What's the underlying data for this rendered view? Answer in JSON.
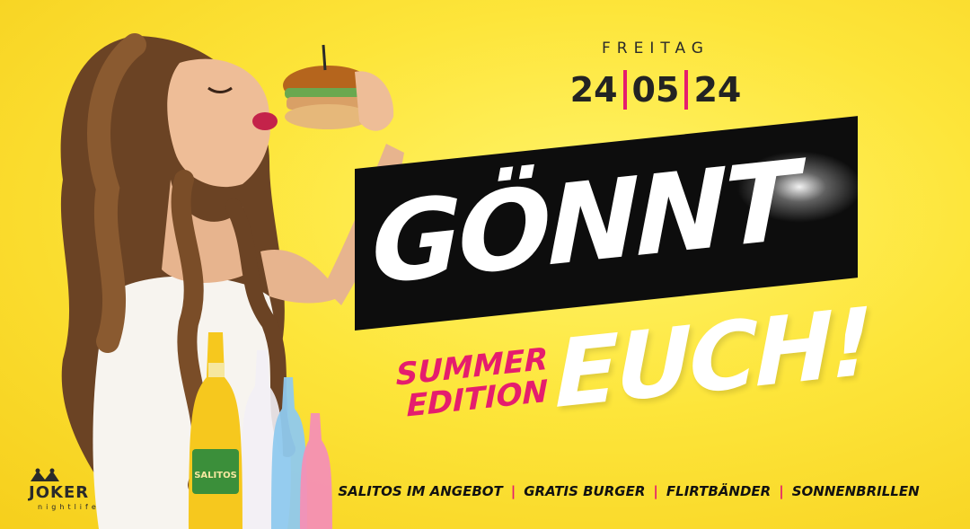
{
  "event": {
    "day": "FREITAG",
    "date_day": "24",
    "date_month": "05",
    "date_year": "24"
  },
  "headline": {
    "word1": "GÖNNT",
    "word2": "EUCH!",
    "edition_line1": "SUMMER",
    "edition_line2": "EDITION"
  },
  "features": [
    "SALITOS IM ANGEBOT",
    "GRATIS BURGER",
    "FLIRTBÄNDER",
    "SONNENBRILLEN"
  ],
  "feature_separator": "|",
  "brand": {
    "name": "JOKER",
    "tagline": "nightlife"
  },
  "bottle_label": "SALITOS",
  "colors": {
    "background": "#fde53a",
    "accent": "#e51d6e",
    "banner": "#0d0d0d",
    "text": "#232323"
  }
}
